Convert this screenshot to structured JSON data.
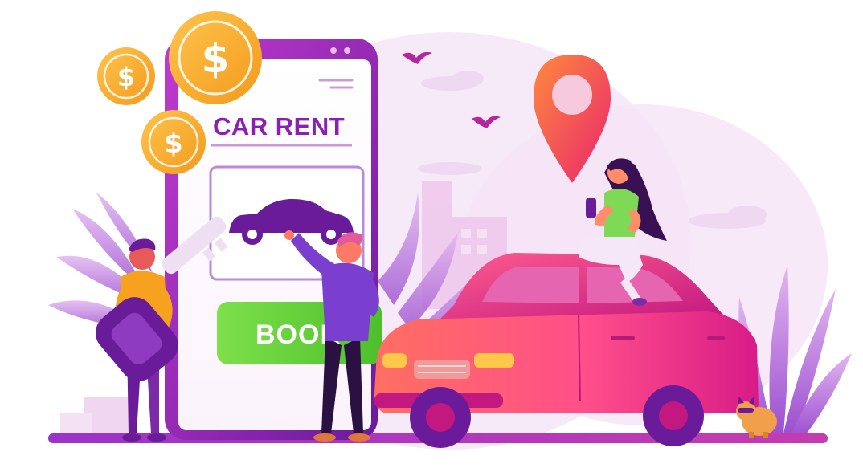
{
  "app": {
    "title": "CAR RENT",
    "book_button_label": "BOOK"
  },
  "palette": {
    "purple_dark": "#6a1b9a",
    "purple": "#8e24aa",
    "magenta": "#c2187f",
    "pink": "#e91e63",
    "coral": "#ff6f61",
    "orange": "#ff9800",
    "gold": "#f9b233",
    "green": "#6fd13a",
    "lavender_bg": "#f3e3f6",
    "light_purple": "#d9b3e6"
  },
  "icons": {
    "coin": "dollar-coin-icon",
    "pin": "map-pin-icon",
    "car": "car-icon",
    "key": "car-key-icon"
  }
}
